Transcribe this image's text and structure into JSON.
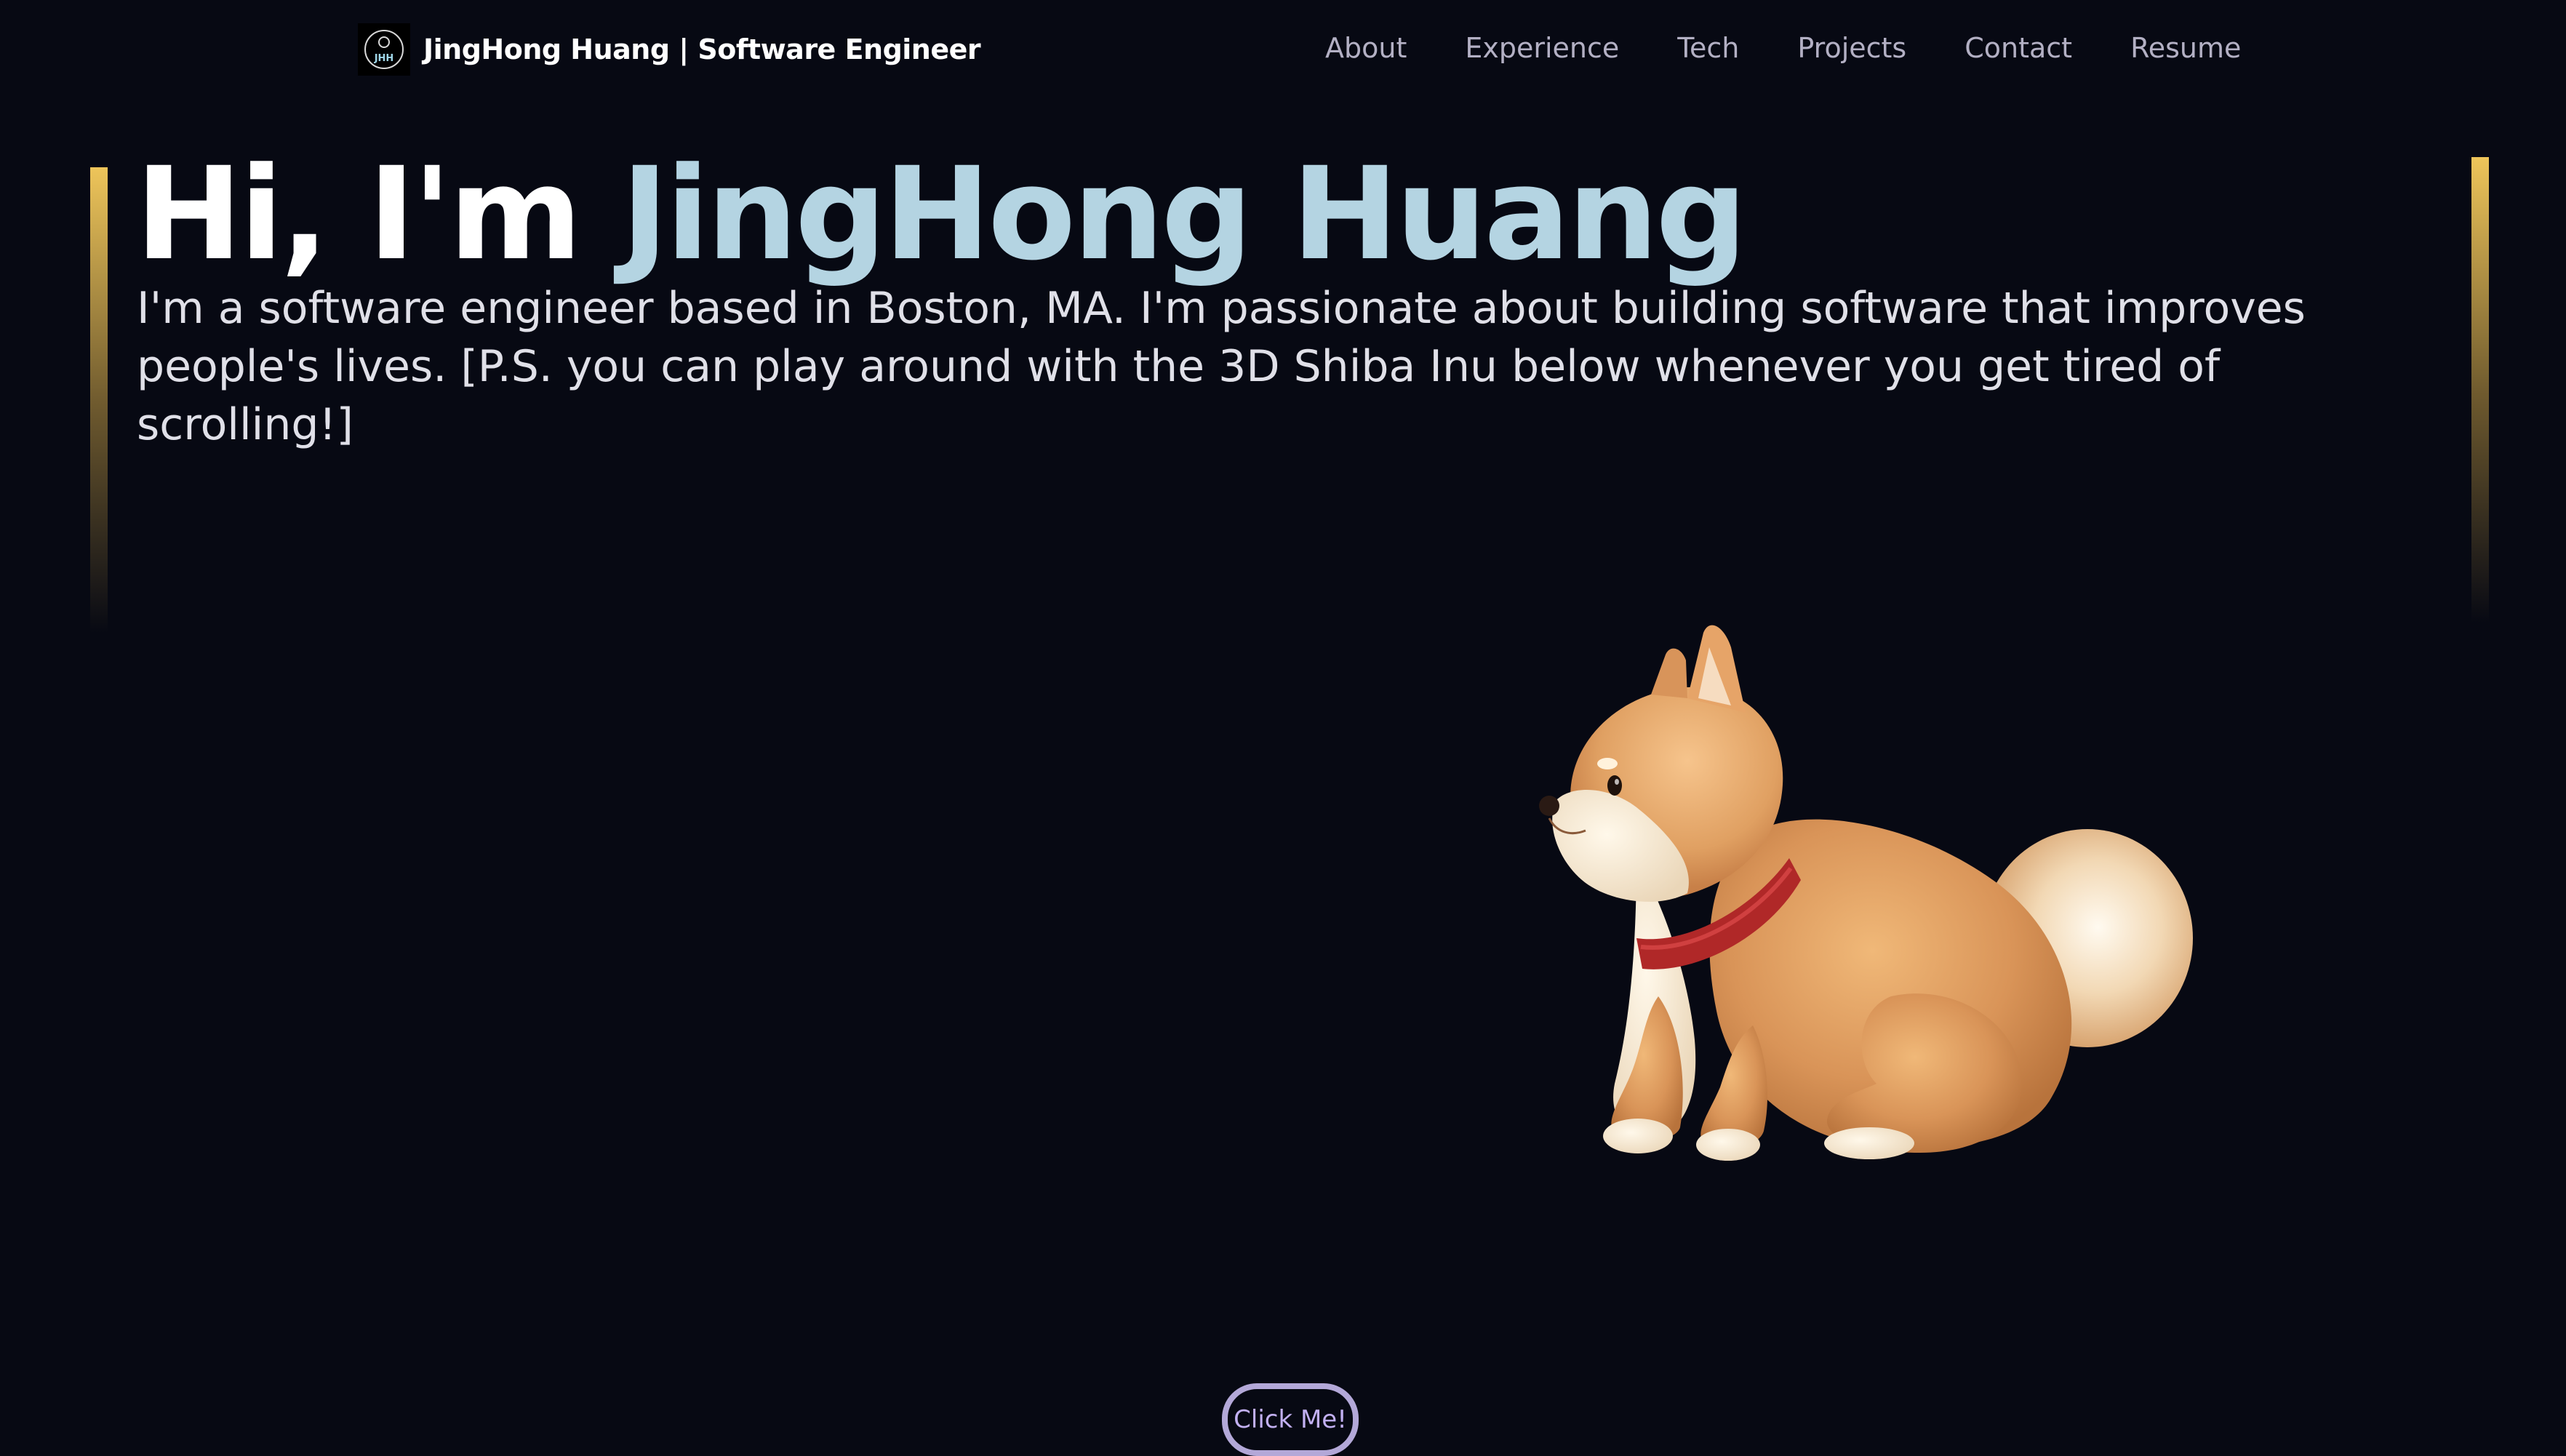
{
  "navbar": {
    "brand_name": "JingHong Huang  | Software Engineer",
    "logo_monogram": "JHH",
    "links": [
      {
        "label": "About"
      },
      {
        "label": "Experience"
      },
      {
        "label": "Tech"
      },
      {
        "label": "Projects"
      },
      {
        "label": "Contact"
      },
      {
        "label": "Resume"
      }
    ]
  },
  "hero": {
    "greeting": "Hi, I'm ",
    "name": "JingHong Huang",
    "subtitle": "I'm a software engineer based in Boston, MA. I'm passionate about building software that improves people's lives. [P.S. you can play around with the 3D Shiba Inu below whenever you get tired of scrolling!]"
  },
  "canvas": {
    "model_icon": "shiba-inu-3d-model"
  },
  "cta": {
    "label": "Click Me!"
  },
  "colors": {
    "background": "#070913",
    "name_accent": "#b4d4e2",
    "bar_gold": "#eec55a",
    "nav_link": "#b3b0c4",
    "button_text": "#c2b0f2",
    "button_border": "#b3a8d8"
  }
}
